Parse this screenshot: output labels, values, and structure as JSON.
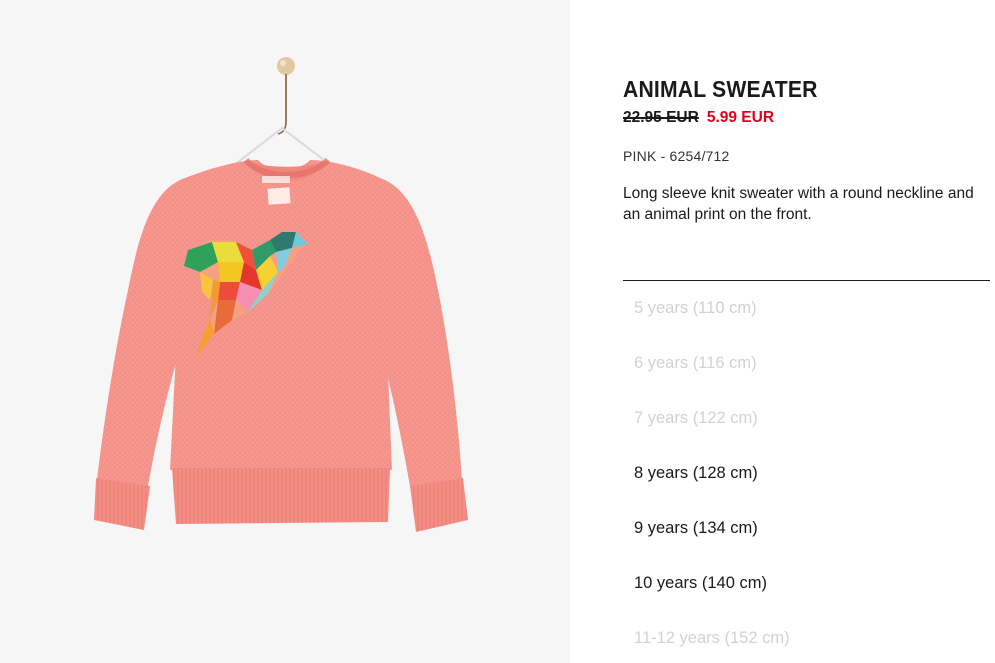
{
  "product": {
    "title": "ANIMAL SWEATER",
    "price_original": "22.95 EUR",
    "price_sale": "5.99 EUR",
    "color_ref": "PINK - 6254/712",
    "description": "Long sleeve knit sweater with a round neckline and an animal print on the front."
  },
  "colors": {
    "sale_price": "#e3001b",
    "sweater": "#f5938a",
    "unavailable_text": "#d2d2d2"
  },
  "sizes": [
    {
      "label": "5 years (110 cm)",
      "available": false
    },
    {
      "label": "6 years (116 cm)",
      "available": false
    },
    {
      "label": "7 years (122 cm)",
      "available": false
    },
    {
      "label": "8 years (128 cm)",
      "available": true
    },
    {
      "label": "9 years (134 cm)",
      "available": true
    },
    {
      "label": "10 years (140 cm)",
      "available": true
    },
    {
      "label": "11-12 years (152 cm)",
      "available": false
    }
  ]
}
